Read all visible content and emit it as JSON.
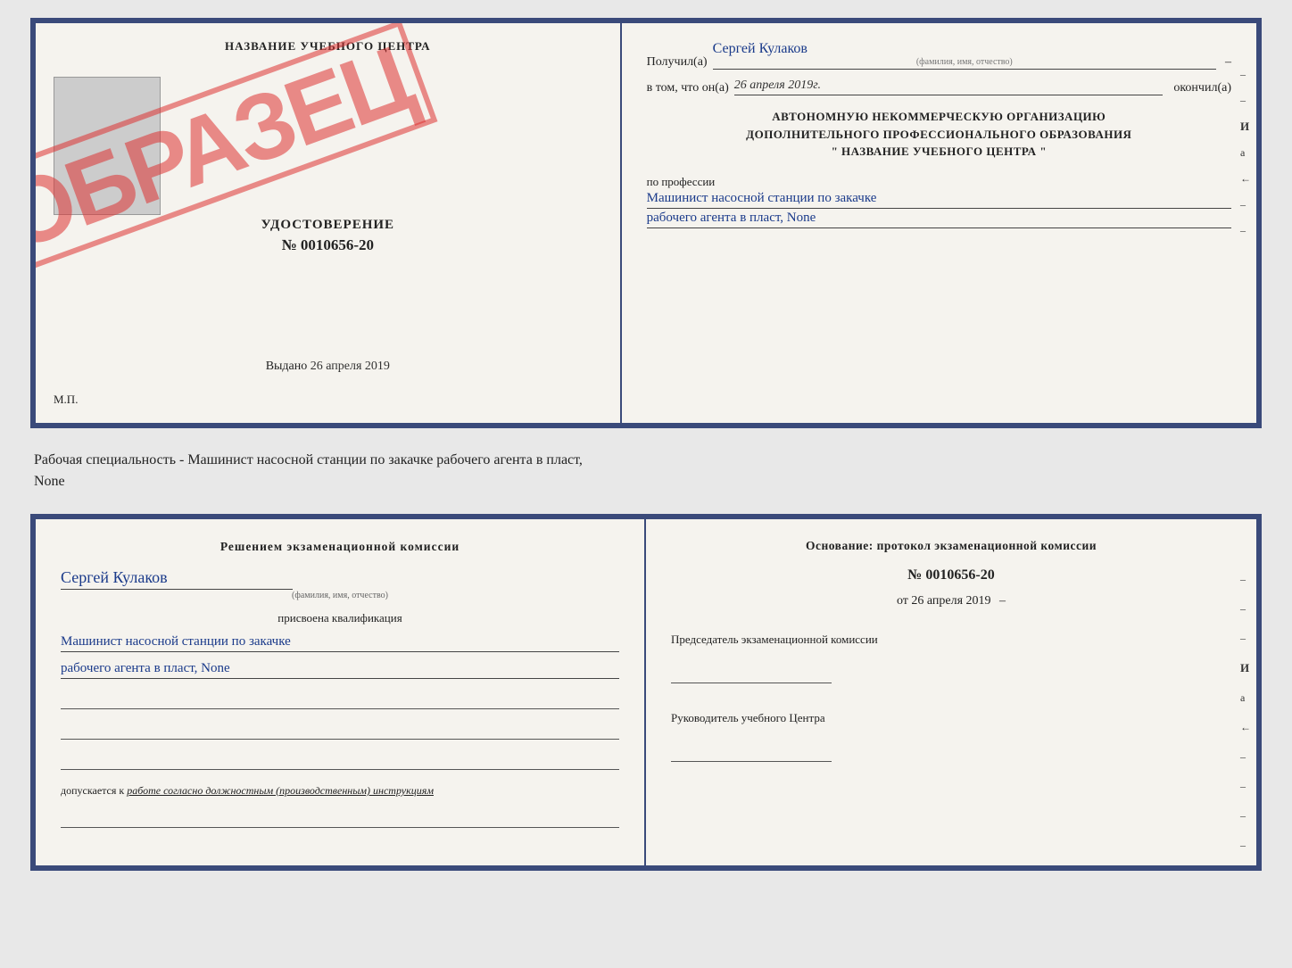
{
  "top_cert": {
    "left": {
      "title": "НАЗВАНИЕ УЧЕБНОГО ЦЕНТРА",
      "stamp": "ОБРАЗЕЦ",
      "udost_title": "УДОСТОВЕРЕНИЕ",
      "udost_number": "№ 0010656-20",
      "vydano_label": "Выдано",
      "vydano_date": "26 апреля 2019",
      "mp_label": "М.П."
    },
    "right": {
      "poluchil_label": "Получил(a)",
      "poluchil_value": "Сергей Кулаков",
      "poluchil_hint": "(фамилия, имя, отчество)",
      "dash1": "–",
      "vtom_label": "в том, что он(а)",
      "vtom_value": "26 апреля 2019г.",
      "okonchil_label": "окончил(а)",
      "org_line1": "АВТОНОМНУЮ НЕКОММЕРЧЕСКУЮ ОРГАНИЗАЦИЮ",
      "org_line2": "ДОПОЛНИТЕЛЬНОГО ПРОФЕССИОНАЛЬНОГО ОБРАЗОВАНИЯ",
      "org_line3": "\"  НАЗВАНИЕ УЧЕБНОГО ЦЕНТРА  \"",
      "dash_org": "–",
      "i_label": "И",
      "a_label": "а",
      "left_arrow": "←",
      "po_professii_label": "по профессии",
      "profession_line1": "Машинист насосной станции по закачке",
      "profession_line2": "рабочего агента в пласт, None",
      "dashes_right": [
        "–",
        "–",
        "–",
        "–",
        "–",
        "–"
      ]
    }
  },
  "specialty_text": "Рабочая специальность - Машинист насосной станции по закачке рабочего агента в пласт,",
  "specialty_text2": "None",
  "bottom_cert": {
    "left": {
      "heading": "Решением экзаменационной комиссии",
      "name_value": "Сергей Кулаков",
      "name_hint": "(фамилия, имя, отчество)",
      "prisvoena_label": "присвоена квалификация",
      "profession_line1": "Машинист насосной станции по закачке",
      "profession_line2": "рабочего агента в пласт, None",
      "допускается_label": "допускается к",
      "допускается_value": "работе согласно должностным (производственным) инструкциям"
    },
    "right": {
      "osnovanie_label": "Основание: протокол экзаменационной комиссии",
      "number_value": "№ 0010656-20",
      "ot_label": "от",
      "date_value": "26 апреля 2019",
      "predsedatel_label": "Председатель экзаменационной комиссии",
      "rukovoditel_label": "Руководитель учебного Центра",
      "dashes_right": [
        "–",
        "–",
        "–",
        "–",
        "–",
        "–",
        "–"
      ]
    }
  }
}
